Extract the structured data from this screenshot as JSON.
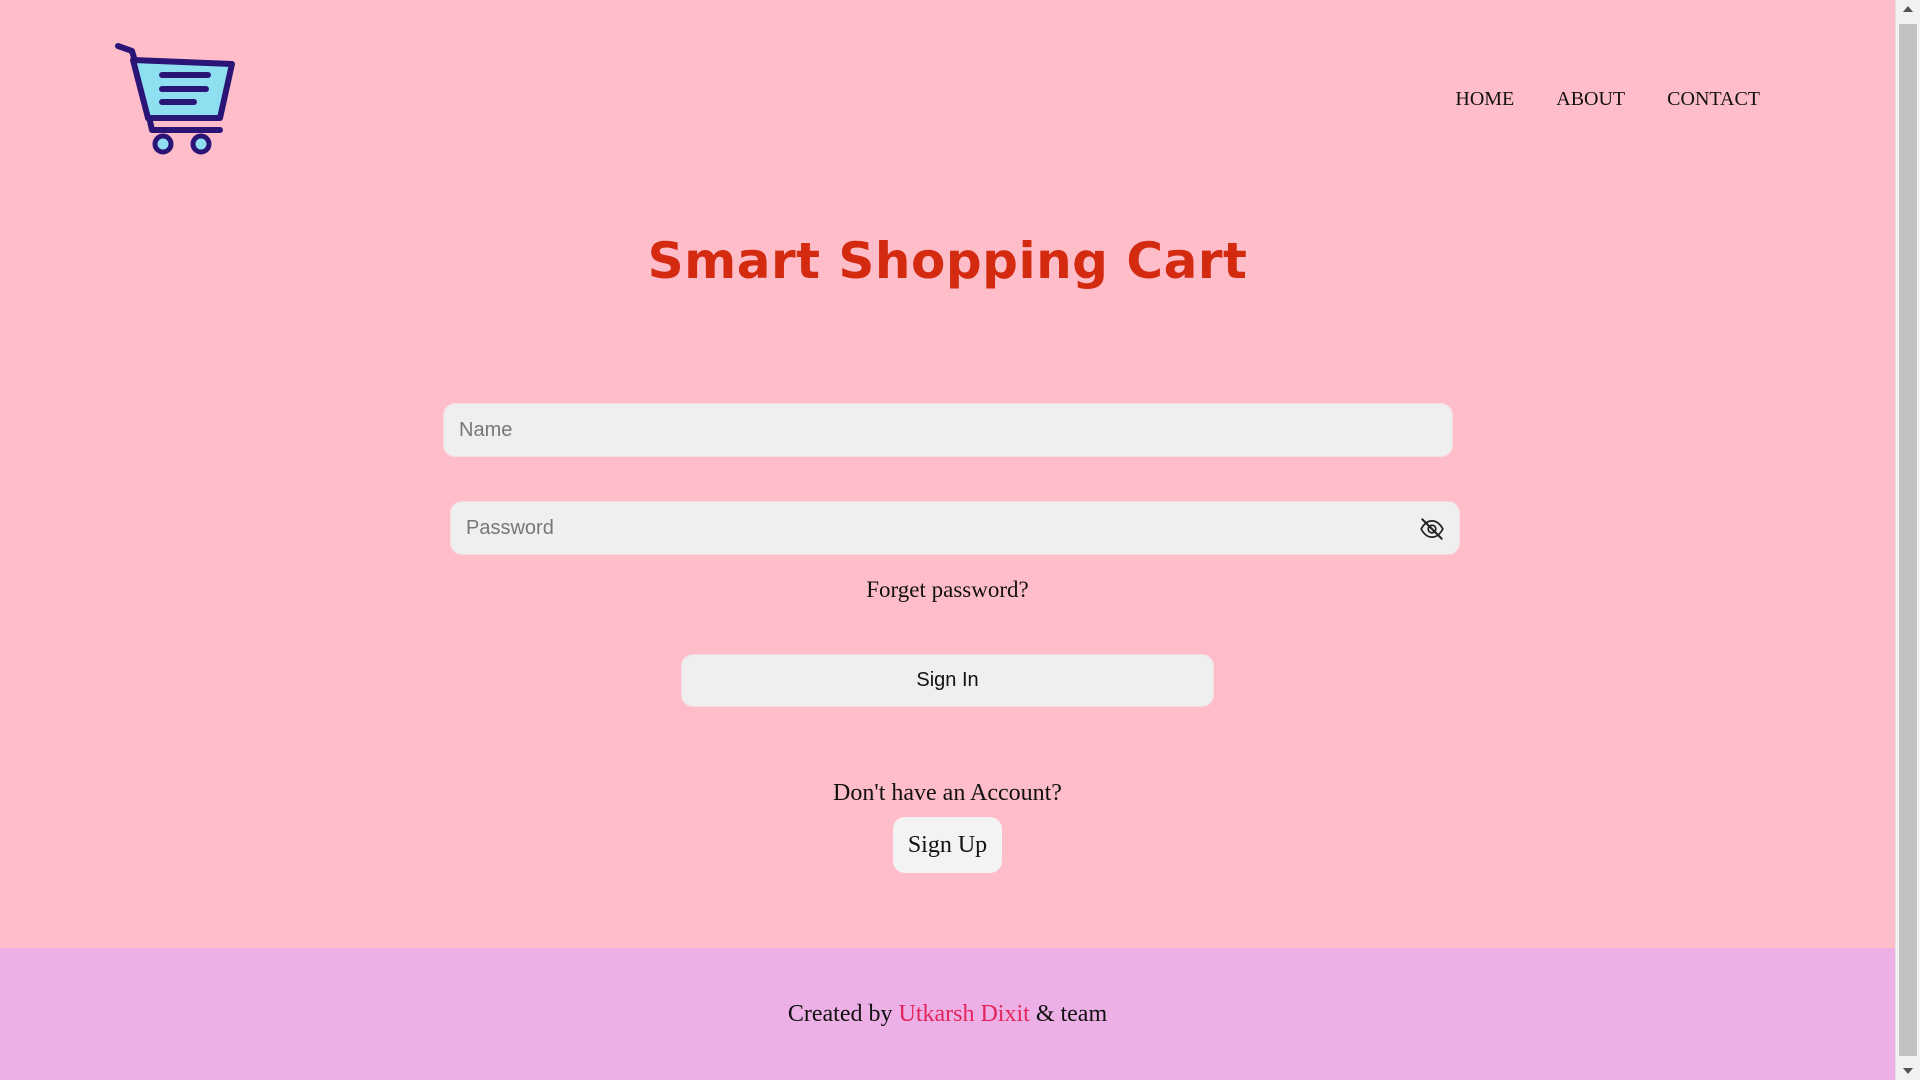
{
  "brand": {
    "logo_icon": "shopping-cart-icon"
  },
  "nav": {
    "items": [
      {
        "label": "HOME"
      },
      {
        "label": "ABOUT"
      },
      {
        "label": "CONTACT"
      }
    ]
  },
  "main": {
    "title": "Smart Shopping Cart",
    "name_placeholder": "Name",
    "password_placeholder": "Password",
    "password_toggle_icon": "eye-slash-icon",
    "forget_label": "Forget password?",
    "signin_label": "Sign In",
    "no_account_text": "Don't have an Account?",
    "signup_label": "Sign Up"
  },
  "footer": {
    "prefix": "Created by",
    "author": "Utkarsh Dixit",
    "suffix": "& team"
  },
  "colors": {
    "background": "#ffbdca",
    "footer_background": "#ecb0e6",
    "title": "#d42a10",
    "author_link": "#e2245a",
    "field_background": "#efefef"
  }
}
